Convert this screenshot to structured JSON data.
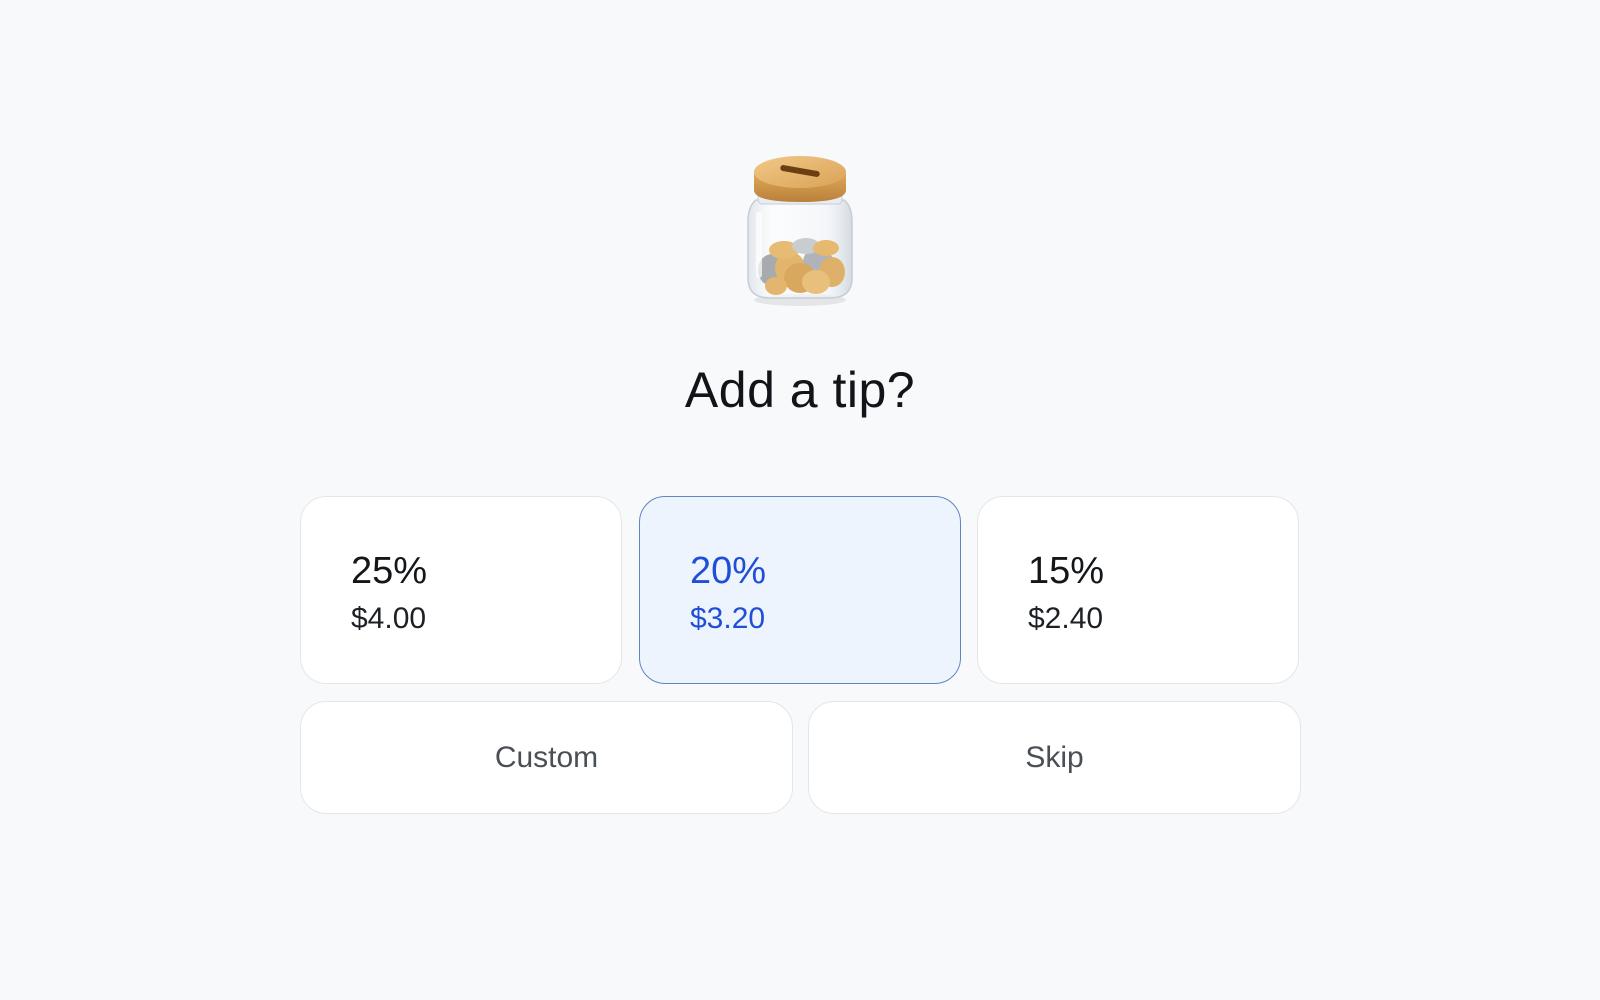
{
  "header": {
    "icon": "tip-jar-icon",
    "title": "Add a tip?"
  },
  "tip_options": [
    {
      "percent": "25%",
      "amount": "$4.00",
      "selected": false
    },
    {
      "percent": "20%",
      "amount": "$3.20",
      "selected": true
    },
    {
      "percent": "15%",
      "amount": "$2.40",
      "selected": false
    }
  ],
  "actions": {
    "custom_label": "Custom",
    "skip_label": "Skip"
  },
  "colors": {
    "background": "#f7f9fb",
    "selected_accent": "#1e4fd6",
    "selected_fill": "#eef4fd",
    "selected_border": "#5f86bd"
  }
}
